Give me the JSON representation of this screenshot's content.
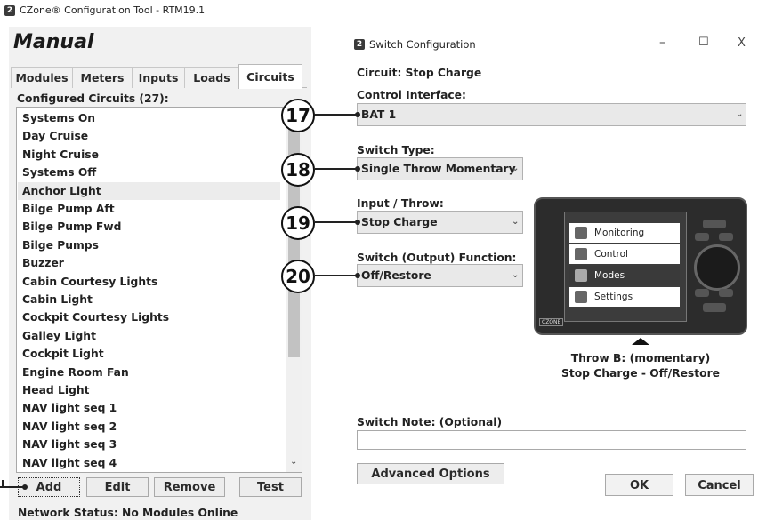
{
  "main_window": {
    "title": "CZone® Configuration Tool - RTM19.1",
    "icon": "czone-app-icon",
    "section_title": "Manual",
    "tabs": [
      "Modules",
      "Meters",
      "Inputs",
      "Loads",
      "Circuits"
    ],
    "active_tab": "Circuits",
    "list_header": "Configured Circuits (27):",
    "circuits": [
      "Systems On",
      "Day Cruise",
      "Night Cruise",
      "Systems Off",
      "Anchor Light",
      "Bilge Pump Aft",
      "Bilge Pump Fwd",
      "Bilge Pumps",
      "Buzzer",
      "Cabin Courtesy Lights",
      "Cabin Light",
      "Cockpit Courtesy Lights",
      "Galley Light",
      "Cockpit Light",
      "Engine Room Fan",
      "Head Light",
      "NAV light seq 1",
      "NAV light seq 2",
      "NAV light seq 3",
      "NAV light seq 4"
    ],
    "selected_circuit": "Anchor Light",
    "buttons": {
      "add": "Add",
      "edit": "Edit",
      "remove": "Remove",
      "test": "Test"
    },
    "network_status": "Network Status:  No Modules Online"
  },
  "dialog": {
    "title": "Switch Configuration",
    "controls": {
      "minimize": "–",
      "maximize": "☐",
      "close": "X"
    },
    "circuit_label": "Circuit: Stop Charge",
    "control_interface_label": "Control Interface:",
    "control_interface_value": "BAT 1",
    "switch_type_label": "Switch Type:",
    "switch_type_value": "Single Throw Momentary",
    "input_throw_label": "Input / Throw:",
    "input_throw_value": "Stop Charge",
    "switch_function_label": "Switch (Output) Function:",
    "switch_function_value": "Off/Restore",
    "device_menu": [
      "Monitoring",
      "Control",
      "Modes",
      "Settings"
    ],
    "device_menu_highlight": "Modes",
    "device_brand": "CZONE",
    "throw_caption_line1": "Throw B: (momentary)",
    "throw_caption_line2": "Stop Charge - Off/Restore",
    "switch_note_label": "Switch Note: (Optional)",
    "switch_note_value": "",
    "buttons": {
      "advanced": "Advanced Options",
      "ok": "OK",
      "cancel": "Cancel"
    }
  },
  "callouts": [
    "17",
    "18",
    "19",
    "20"
  ],
  "colors": {
    "panel_bg": "#f1f1f1",
    "selection": "#ececec",
    "device_body": "#2c2c2c"
  }
}
